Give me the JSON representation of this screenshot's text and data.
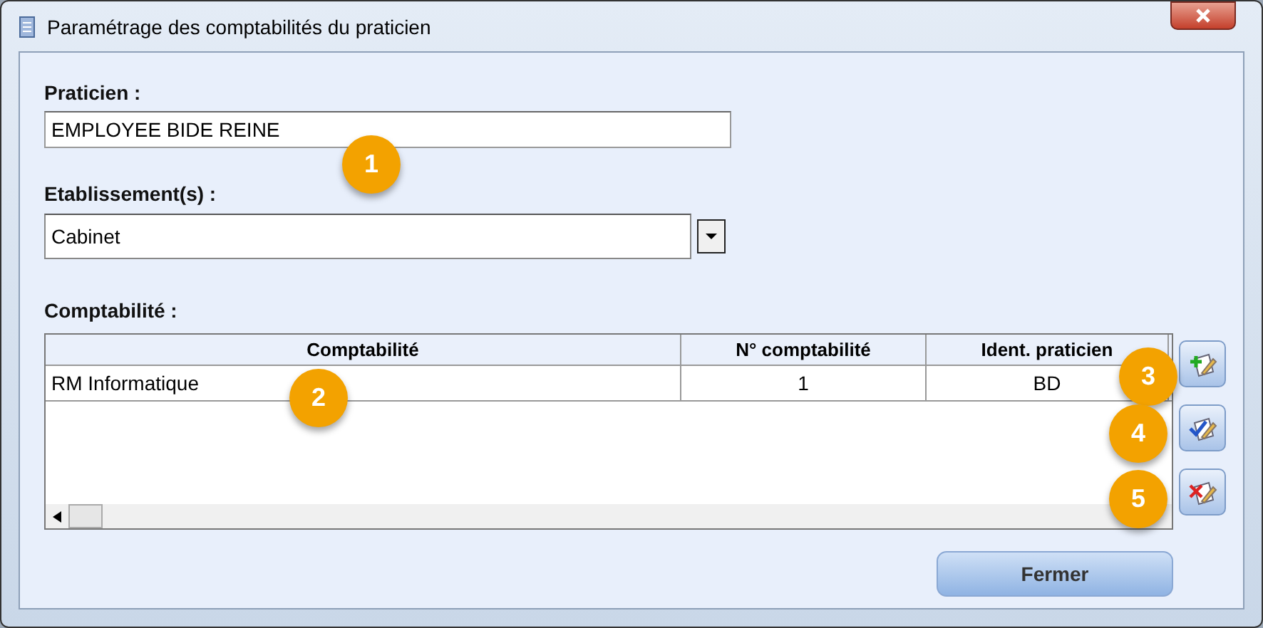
{
  "window": {
    "title": "Paramétrage des comptabilités du praticien"
  },
  "praticien": {
    "label": "Praticien :",
    "value": "EMPLOYEE BIDE REINE"
  },
  "etablissement": {
    "label": "Etablissement(s) :",
    "value": "Cabinet"
  },
  "comptabilite": {
    "label": "Comptabilité :",
    "table": {
      "columns": [
        "Comptabilité",
        "N° comptabilité",
        "Ident. praticien"
      ],
      "rows": [
        {
          "cells": [
            "RM Informatique",
            "1",
            "BD"
          ]
        }
      ]
    }
  },
  "side_buttons": [
    {
      "kind": "add"
    },
    {
      "kind": "edit"
    },
    {
      "kind": "delete"
    }
  ],
  "buttons": [
    "Fermer"
  ],
  "callouts": [
    {
      "label": "1"
    },
    {
      "label": "2"
    },
    {
      "label": "3"
    },
    {
      "label": "4"
    },
    {
      "label": "5"
    }
  ]
}
